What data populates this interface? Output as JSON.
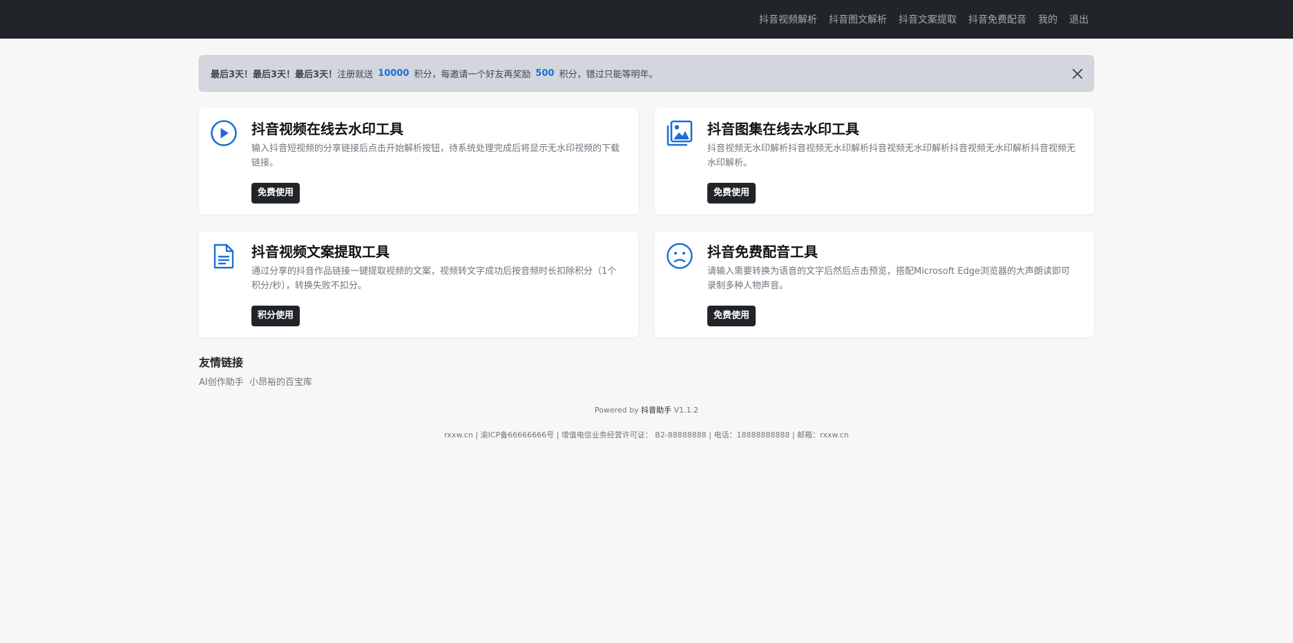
{
  "nav": {
    "items": [
      "抖音视频解析",
      "抖音图文解析",
      "抖音文案提取",
      "抖音免费配音",
      "我的",
      "退出"
    ]
  },
  "alert": {
    "prefix": "最后3天！最后3天！最后3天！",
    "text1": "注册就送",
    "num1": "10000",
    "text2": "积分，每邀请一个好友再奖励",
    "num2": "500",
    "text3": "积分，错过只能等明年。"
  },
  "cards": [
    {
      "title": "抖音视频在线去水印工具",
      "desc": "输入抖音短视频的分享链接后点击开始解析按钮，待系统处理完成后将显示无水印视频的下载链接。",
      "button": "免费使用",
      "icon": "play-circle-icon"
    },
    {
      "title": "抖音图集在线去水印工具",
      "desc": "抖音视频无水印解析抖音视频无水印解析抖音视频无水印解析抖音视频无水印解析抖音视频无水印解析。",
      "button": "免费使用",
      "icon": "images-icon"
    },
    {
      "title": "抖音视频文案提取工具",
      "desc": "通过分享的抖音作品链接一键提取视频的文案，视频转文字成功后按音频时长扣除积分（1个积分/秒），转换失败不扣分。",
      "button": "积分使用",
      "icon": "file-text-icon"
    },
    {
      "title": "抖音免费配音工具",
      "desc": "请输入需要转换为语音的文字后然后点击预览，搭配Microsoft Edge浏览器的大声朗读即可录制多种人物声音。",
      "button": "免费使用",
      "icon": "frown-icon"
    }
  ],
  "friends": {
    "title": "友情链接",
    "links": [
      "AI创作助手",
      "小昂裕的百宝库"
    ]
  },
  "footer": {
    "powered_prefix": "Powered by",
    "brand": "抖音助手",
    "version": "V1.1.2",
    "icp": "rxxw.cn | 渝ICP备66666666号 | 增值电信业务经营许可证： B2-88888888 | 电话：18888888888 | 邮箱：rxxw.cn"
  },
  "colors": {
    "accent": "#1c6ed4",
    "navbar": "#212529",
    "button": "#212529"
  }
}
